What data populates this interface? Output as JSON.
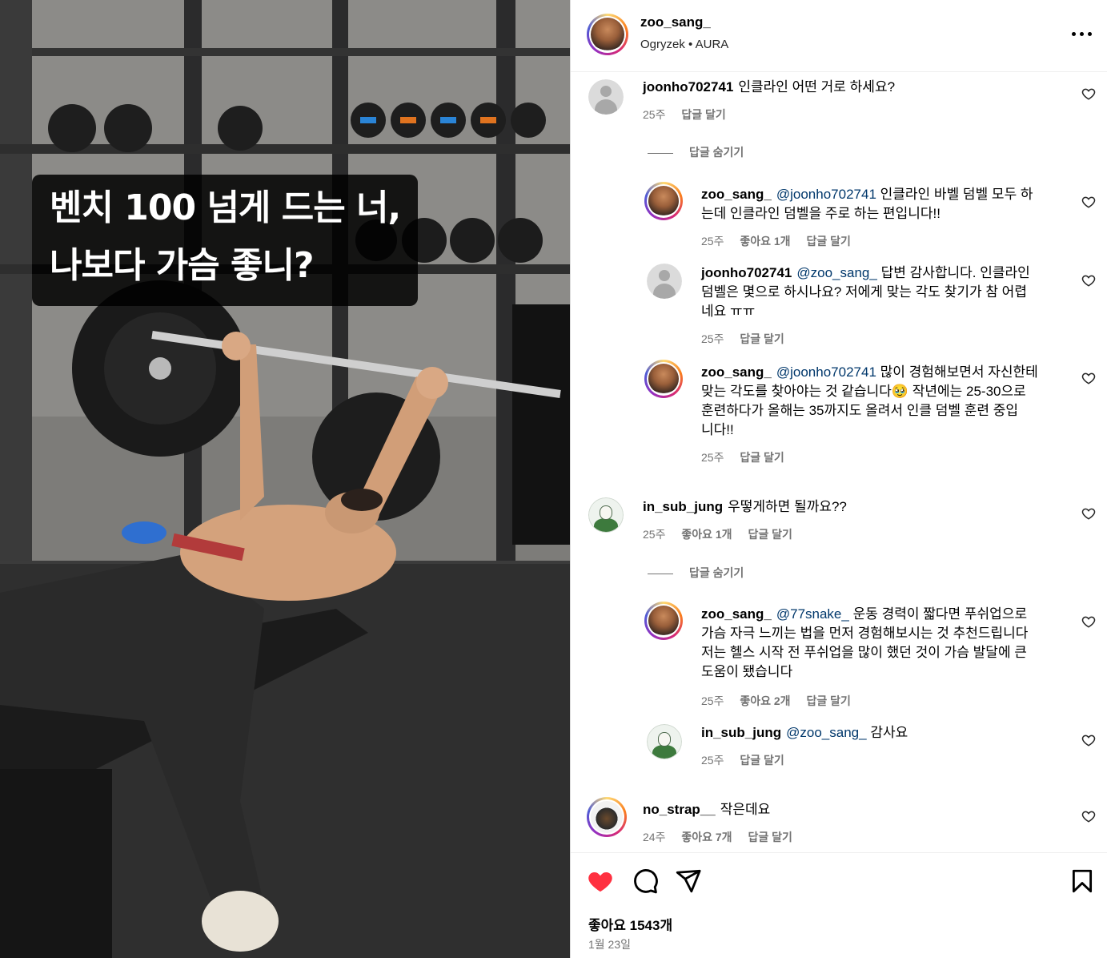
{
  "video": {
    "caption_lines": [
      "벤치 100 넘게 드는 너,",
      "나보다 가슴 좋니?"
    ]
  },
  "post": {
    "username": "zoo_sang_",
    "audio_artist": "Ogryzek",
    "audio_separator": "•",
    "audio_track": "AURA",
    "likes_text": "좋아요 1543개",
    "date": "1월 23일"
  },
  "comments": [
    {
      "username": "joonho702741",
      "text": "인클라인 어떤 거로 하세요?",
      "time": "25주",
      "reply_label": "답글 달기",
      "toggle_label": "답글 숨기기",
      "replies": [
        {
          "username": "zoo_sang_",
          "mention": "@joonho702741",
          "lines": [
            "인클라인 바벨 덤벨 모두 하",
            "는데 인클라인 덤벨을 주로 하는 편입니다!!"
          ],
          "time": "25주",
          "likes": "좋아요 1개",
          "reply_label": "답글 달기"
        },
        {
          "username": "joonho702741",
          "mention": "@zoo_sang_",
          "lines": [
            "답변 감사합니다. 인클라인",
            "덤벨은 몇으로 하시나요? 저에게 맞는 각도 찾기가 참 어렵",
            "네요 ㅠㅠ"
          ],
          "time": "25주",
          "reply_label": "답글 달기"
        },
        {
          "username": "zoo_sang_",
          "mention": "@joonho702741",
          "lines": [
            "많이 경험해보면서 자신한테",
            "맞는 각도를 찾아야는 것 같습니다🥹 작년에는 25-30으로",
            "훈련하다가 올해는 35까지도 올려서 인클 덤벨 훈련 중입",
            "니다!!"
          ],
          "time": "25주",
          "reply_label": "답글 달기"
        }
      ]
    },
    {
      "username": "in_sub_jung",
      "text": "우떻게하면 될까요??",
      "time": "25주",
      "likes": "좋아요 1개",
      "reply_label": "답글 달기",
      "toggle_label": "답글 숨기기",
      "replies": [
        {
          "username": "zoo_sang_",
          "mention": "@77snake_",
          "lines": [
            "운동 경력이 짧다면 푸쉬업으로",
            "가슴 자극 느끼는 법을 먼저 경험해보시는 것 추천드립니다",
            "저는 헬스 시작 전 푸쉬업을 많이 했던 것이 가슴 발달에 큰",
            "도움이 됐습니다"
          ],
          "time": "25주",
          "likes": "좋아요 2개",
          "reply_label": "답글 달기"
        },
        {
          "username": "in_sub_jung",
          "mention": "@zoo_sang_",
          "lines": [
            "감사요"
          ],
          "time": "25주",
          "reply_label": "답글 달기"
        }
      ]
    },
    {
      "username": "no_strap__",
      "text": "작은데요",
      "time": "24주",
      "likes": "좋아요 7개",
      "reply_label": "답글 달기"
    }
  ],
  "colors": {
    "like_heart": "#ff3040",
    "mention": "#00376b",
    "secondary_text": "#737373"
  },
  "icons": [
    "more-options-icon",
    "heart-outline-icon",
    "heart-filled-icon",
    "comment-icon",
    "share-icon",
    "bookmark-icon"
  ]
}
